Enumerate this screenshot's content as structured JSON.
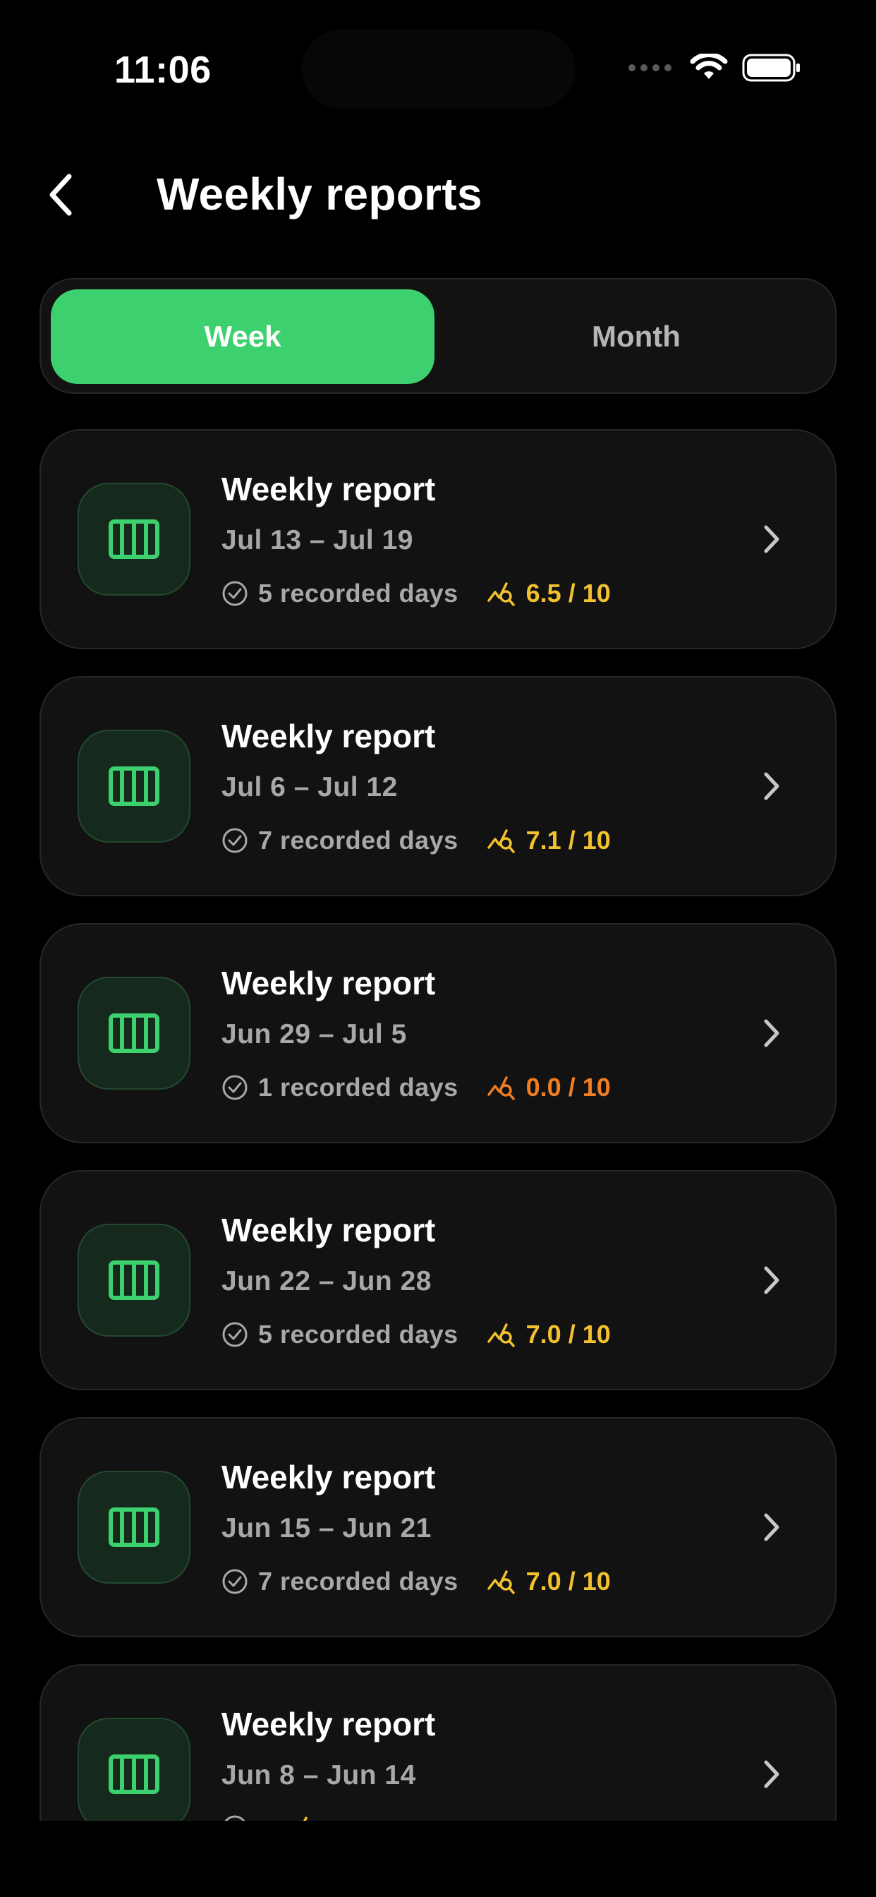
{
  "status_bar": {
    "time": "11:06"
  },
  "header": {
    "title": "Weekly reports"
  },
  "tabs": [
    {
      "label": "Week",
      "active": true
    },
    {
      "label": "Month",
      "active": false
    }
  ],
  "reports": [
    {
      "title": "Weekly report",
      "range": "Jul 13 – Jul 19",
      "days": "5 recorded days",
      "score": "6.5 / 10",
      "score_color": "#f2c12e"
    },
    {
      "title": "Weekly report",
      "range": "Jul 6 – Jul 12",
      "days": "7 recorded days",
      "score": "7.1 / 10",
      "score_color": "#f2c12e"
    },
    {
      "title": "Weekly report",
      "range": "Jun 29 – Jul 5",
      "days": "1 recorded days",
      "score": "0.0 / 10",
      "score_color": "#ef7d22"
    },
    {
      "title": "Weekly report",
      "range": "Jun 22 – Jun 28",
      "days": "5 recorded days",
      "score": "7.0 / 10",
      "score_color": "#f2c12e"
    },
    {
      "title": "Weekly report",
      "range": "Jun 15 – Jun 21",
      "days": "7 recorded days",
      "score": "7.0 / 10",
      "score_color": "#f2c12e"
    },
    {
      "title": "Weekly report",
      "range": "Jun 8 – Jun 14",
      "days": "",
      "score": "",
      "score_color": "#f2c12e"
    }
  ],
  "icons": {
    "back": "chevron-left-icon",
    "report": "calendar-week-icon",
    "days": "check-circle-icon",
    "score": "trend-search-icon",
    "open": "chevron-right-icon"
  },
  "colors": {
    "accent": "#3dd06f",
    "background": "#000000",
    "card": "#121212",
    "score_warning": "#ef7d22",
    "score_normal": "#f2c12e"
  }
}
